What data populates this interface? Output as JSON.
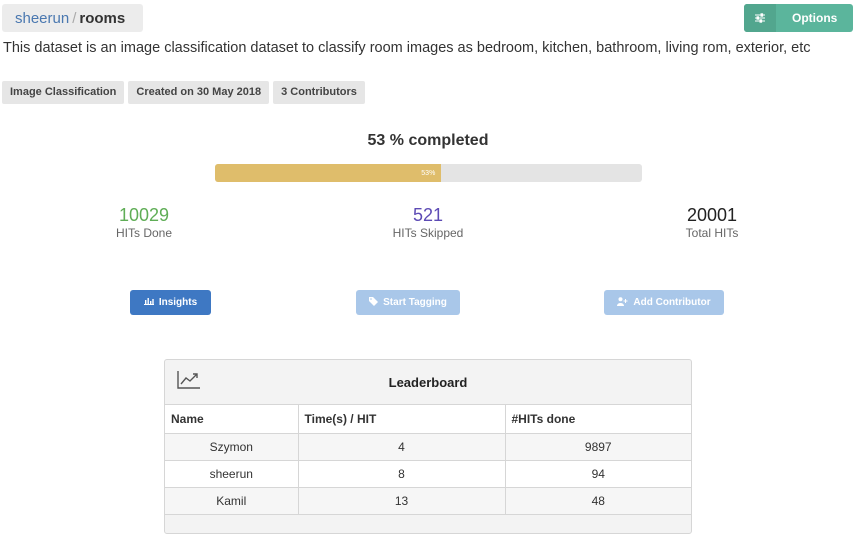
{
  "breadcrumb": {
    "owner": "sheerun",
    "separator": "/",
    "dataset": "rooms"
  },
  "options_label": "Options",
  "description": "This dataset is an image classification dataset to classify room images as bedroom, kitchen, bathroom, living rom, exterior, etc",
  "tags": [
    "Image Classification",
    "Created on 30 May 2018",
    "3 Contributors"
  ],
  "progress": {
    "title": "53 % completed",
    "percent": 53,
    "label": "53%"
  },
  "stats": {
    "done": {
      "value": "10029",
      "label": "HITs Done"
    },
    "skipped": {
      "value": "521",
      "label": "HITs Skipped"
    },
    "total": {
      "value": "20001",
      "label": "Total HITs"
    }
  },
  "actions": {
    "insights": "Insights",
    "start_tagging": "Start Tagging",
    "add_contributor": "Add Contributor"
  },
  "leaderboard": {
    "title": "Leaderboard",
    "columns": [
      "Name",
      "Time(s) / HIT",
      "#HITs done"
    ],
    "rows": [
      [
        "Szymon",
        "4",
        "9897"
      ],
      [
        "sheerun",
        "8",
        "94"
      ],
      [
        "Kamil",
        "13",
        "48"
      ]
    ]
  },
  "colors": {
    "options": "#5bb59c",
    "progress": "#dfbd6b",
    "done": "#5fad56",
    "skipped": "#5c4ab4",
    "primary_button": "#3e78c3",
    "disabled_button": "#a9c7e9"
  }
}
